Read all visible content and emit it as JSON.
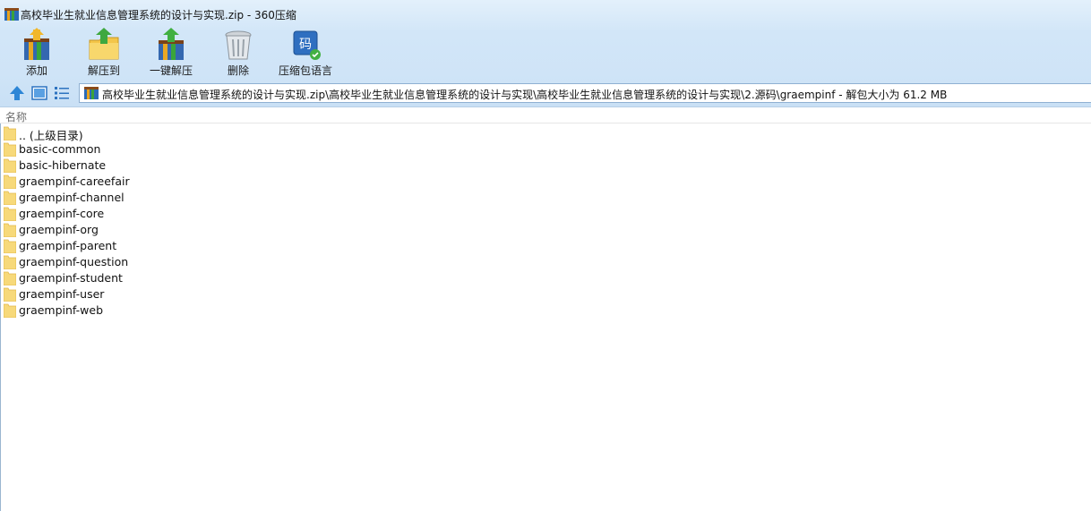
{
  "window": {
    "title": "高校毕业生就业信息管理系统的设计与实现.zip - 360压缩"
  },
  "toolbar": {
    "items": [
      {
        "label": "添加",
        "icon": "add-archive-icon"
      },
      {
        "label": "解压到",
        "icon": "extract-to-icon"
      },
      {
        "label": "一键解压",
        "icon": "one-click-extract-icon"
      },
      {
        "label": "删除",
        "icon": "delete-trash-icon"
      },
      {
        "label": "压缩包语言",
        "icon": "archive-language-icon"
      }
    ]
  },
  "address": {
    "path": "高校毕业生就业信息管理系统的设计与实现.zip\\高校毕业生就业信息管理系统的设计与实现\\高校毕业生就业信息管理系统的设计与实现\\2.源码\\graempinf - 解包大小为 61.2 MB"
  },
  "columns": {
    "name": "名称"
  },
  "files": [
    ".. (上级目录)",
    "basic-common",
    "basic-hibernate",
    "graempinf-careefair",
    "graempinf-channel",
    "graempinf-core",
    "graempinf-org",
    "graempinf-parent",
    "graempinf-question",
    "graempinf-student",
    "graempinf-user",
    "graempinf-web"
  ]
}
